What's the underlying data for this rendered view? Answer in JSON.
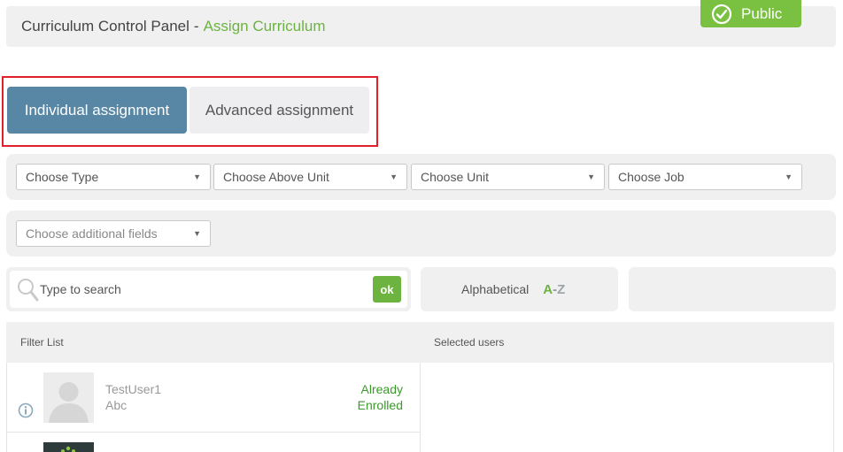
{
  "header": {
    "title": "Curriculum Control Panel",
    "separator": "-",
    "active_crumb": "Assign Curriculum"
  },
  "badge": {
    "label": "Public",
    "icon": "check-circle-icon"
  },
  "tabs": [
    {
      "label": "Individual assignment",
      "active": true
    },
    {
      "label": "Advanced assignment",
      "active": false
    }
  ],
  "filters": {
    "type": "Choose Type",
    "above_unit": "Choose Above Unit",
    "unit": "Choose Unit",
    "job": "Choose Job",
    "additional": "Choose additional fields"
  },
  "search": {
    "placeholder": "Type to search",
    "button": "ok"
  },
  "sort": {
    "label": "Alphabetical",
    "a": "A",
    "dash": "-",
    "z": "Z"
  },
  "lists": {
    "filter_header": "Filter List",
    "selected_header": "Selected users"
  },
  "users": [
    {
      "name": "TestUser1",
      "sub": "Abc",
      "status_line1": "Already",
      "status_line2": "Enrolled"
    }
  ],
  "colors": {
    "accent_green": "#6cb33f",
    "tab_active": "#5787a5",
    "highlight_border": "#e0202a"
  }
}
